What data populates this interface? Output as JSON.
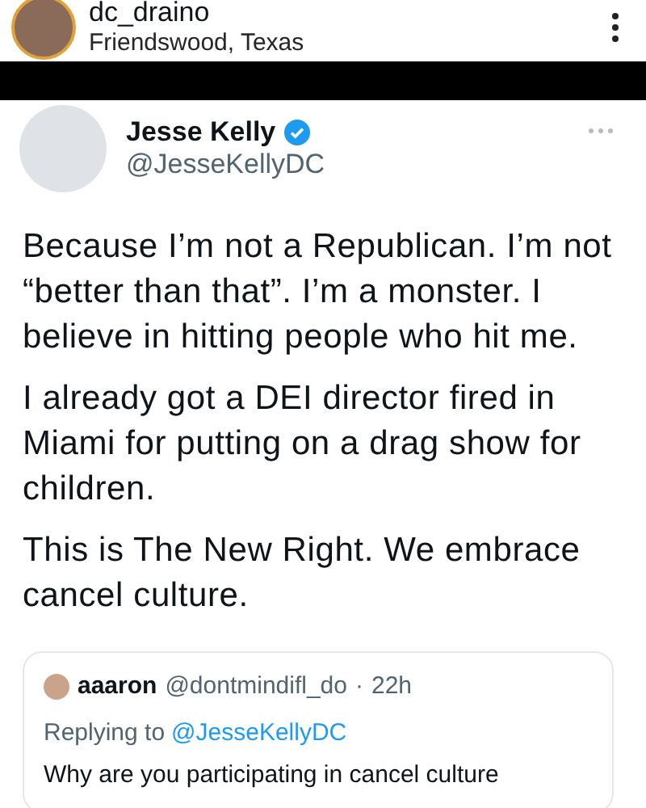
{
  "post_header": {
    "username": "dc_draino",
    "location": "Friendswood, Texas"
  },
  "tweet": {
    "name": "Jesse Kelly",
    "verified": true,
    "handle": "@JesseKellyDC",
    "paragraphs": [
      "Because I’m not a Republican. I’m not “better than that”. I’m a monster. I believe in hitting people who hit me.",
      "I already got a DEI director fired in Miami for putting on a drag show for children.",
      "This is The New Right. We embrace cancel culture."
    ],
    "quoted": {
      "name": "aaaron",
      "handle": "@dontmindifl_do",
      "separator": "·",
      "time": "22h",
      "replying_prefix": "Replying to",
      "replying_handle": "@JesseKellyDC",
      "text": "Why are you participating in cancel culture"
    }
  }
}
